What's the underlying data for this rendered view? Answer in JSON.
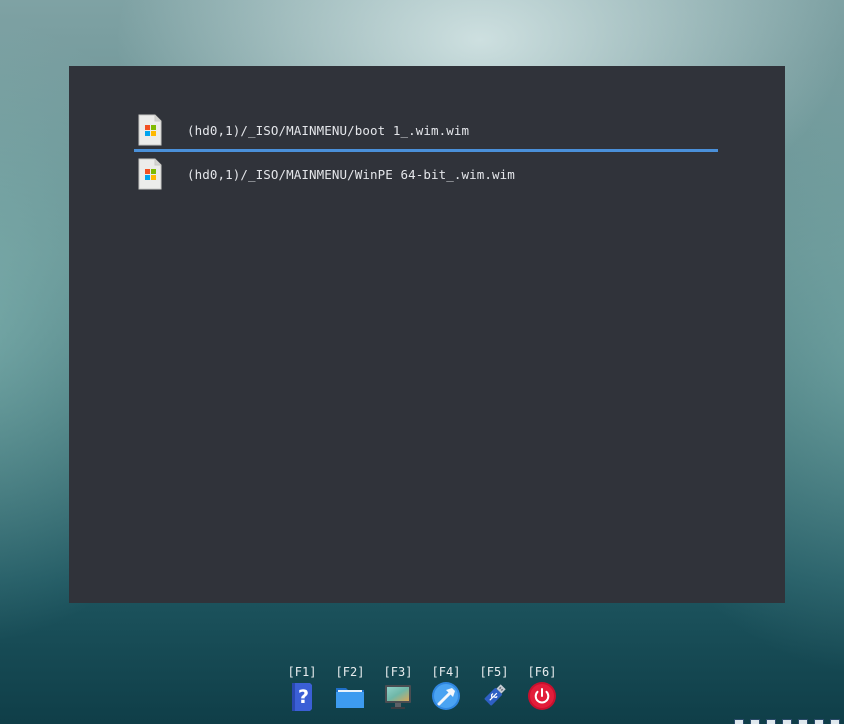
{
  "boot_menu": {
    "entries": [
      {
        "label": "(hd0,1)/_ISO/MAINMENU/boot 1_.wim.wim",
        "icon": "windows-file-icon",
        "selected": true
      },
      {
        "label": "(hd0,1)/_ISO/MAINMENU/WinPE 64-bit_.wim.wim",
        "icon": "windows-file-icon",
        "selected": false
      }
    ],
    "selection_color": "#4a90d9",
    "panel_color": "#30333a"
  },
  "taskbar": {
    "keys": [
      {
        "label": "[F1]",
        "icon": "help-icon"
      },
      {
        "label": "[F2]",
        "icon": "folder-icon"
      },
      {
        "label": "[F3]",
        "icon": "display-icon"
      },
      {
        "label": "[F4]",
        "icon": "tools-icon"
      },
      {
        "label": "[F5]",
        "icon": "usb-drive-icon"
      },
      {
        "label": "[F6]",
        "icon": "power-icon"
      }
    ]
  }
}
